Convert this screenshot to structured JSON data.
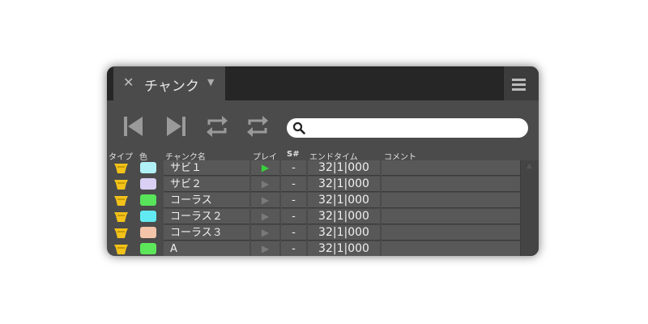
{
  "tab": {
    "title": "チャンク"
  },
  "search": {
    "value": "",
    "placeholder": ""
  },
  "columns": {
    "type": "タイプ",
    "color": "色",
    "name": "チャンク名",
    "play": "プレイ",
    "section": "S#",
    "end_time": "エンドタイム",
    "comment": "コメント"
  },
  "rows": [
    {
      "name": "サビ１",
      "color": "#b0f0f6",
      "play": "▶",
      "playing": true,
      "section": "-",
      "end_time": "32|1|000",
      "comment": ""
    },
    {
      "name": "サビ２",
      "color": "#d9d0f4",
      "play": "▶",
      "playing": false,
      "section": "-",
      "end_time": "32|1|000",
      "comment": ""
    },
    {
      "name": "コーラス",
      "color": "#58e35a",
      "play": "▶",
      "playing": false,
      "section": "-",
      "end_time": "32|1|000",
      "comment": ""
    },
    {
      "name": "コーラス２",
      "color": "#62eaf2",
      "play": "▶",
      "playing": false,
      "section": "-",
      "end_time": "32|1|000",
      "comment": ""
    },
    {
      "name": "コーラス３",
      "color": "#f2c4a9",
      "play": "▶",
      "playing": false,
      "section": "-",
      "end_time": "32|1|000",
      "comment": ""
    },
    {
      "name": "A",
      "color": "#5de65a",
      "play": "▶",
      "playing": false,
      "section": "-",
      "end_time": "32|1|000",
      "comment": ""
    }
  ],
  "icons": {
    "close": "close-icon",
    "dropdown": "chevron-down-icon",
    "menu": "hamburger-menu-icon",
    "prev": "skip-to-start-icon",
    "next": "skip-to-end-icon",
    "loop_a": "repeat-icon",
    "loop_b": "repeat-off-icon",
    "search": "search-icon",
    "type": "chunk-type-icon"
  },
  "colors": {
    "panel_bg": "#4b4b4b",
    "tabbar_bg": "#262626",
    "type_icon": "#f2c21a",
    "play_active": "#39d13c",
    "play_inactive": "#7a7a7a"
  }
}
